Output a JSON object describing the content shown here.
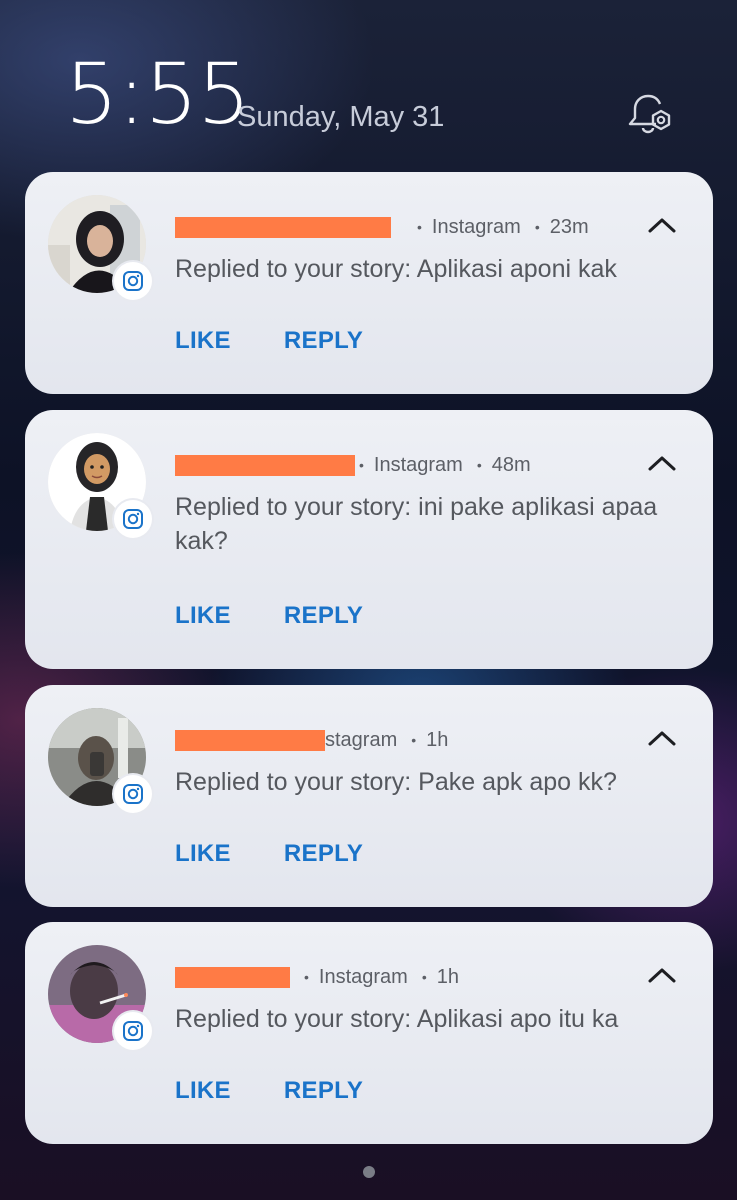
{
  "lockscreen": {
    "time": "5:55",
    "date": "Sunday, May 31",
    "settings_icon": "notification-settings-icon"
  },
  "notifications": [
    {
      "app": "Instagram",
      "age": "23m",
      "message": "Replied to your story: Aplikasi aponi kak",
      "actions": {
        "like": "LIKE",
        "reply": "REPLY"
      }
    },
    {
      "app": "Instagram",
      "age": "48m",
      "message": "Replied to your story: ini pake aplikasi apaa kak?",
      "actions": {
        "like": "LIKE",
        "reply": "REPLY"
      }
    },
    {
      "app": "stagram",
      "age": "1h",
      "message": "Replied to your story: Pake apk apo kk?",
      "actions": {
        "like": "LIKE",
        "reply": "REPLY"
      }
    },
    {
      "app": "Instagram",
      "age": "1h",
      "message": "Replied to your story: Aplikasi apo itu ka",
      "actions": {
        "like": "LIKE",
        "reply": "REPLY"
      }
    }
  ],
  "colors": {
    "action": "#1a73c9",
    "redaction": "#ff7b45",
    "card": "#eef0f5"
  }
}
